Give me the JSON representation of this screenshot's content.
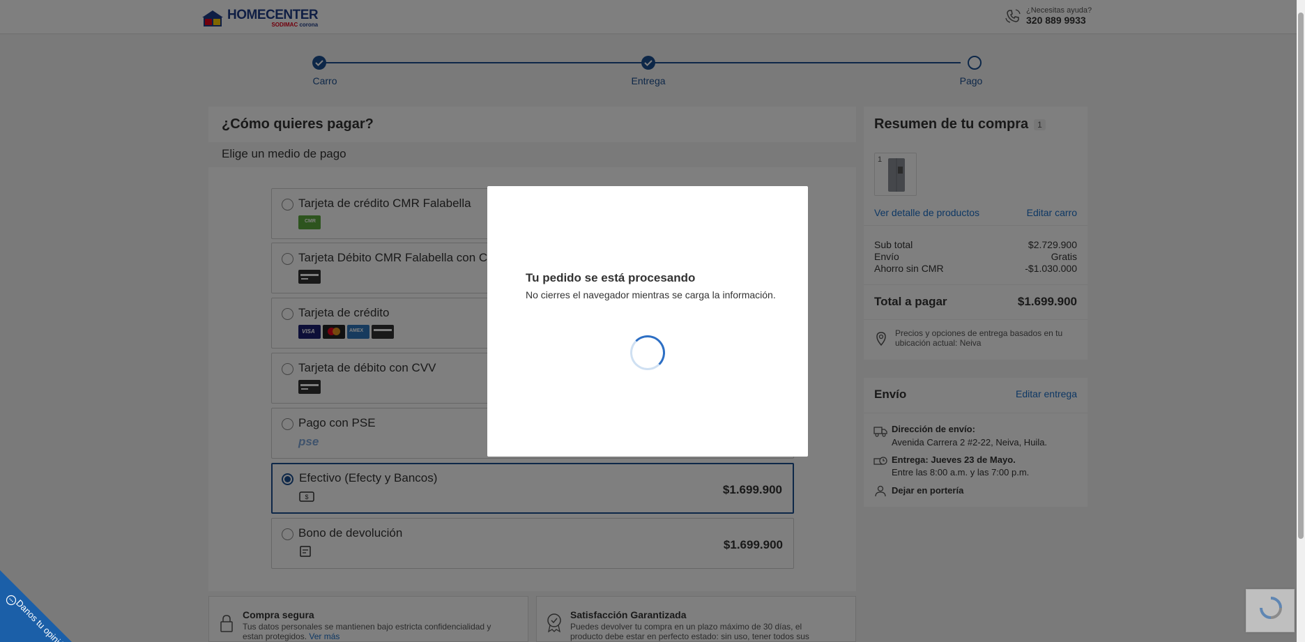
{
  "header": {
    "logo_main": "HOMECENTER",
    "logo_sub_a": "SODIMAC",
    "logo_sub_b": "corona",
    "help_label": "¿Necesitas ayuda?",
    "help_phone": "320 889 9933"
  },
  "stepper": {
    "steps": [
      {
        "label": "Carro",
        "state": "done"
      },
      {
        "label": "Entrega",
        "state": "done"
      },
      {
        "label": "Pago",
        "state": "current"
      }
    ]
  },
  "payment": {
    "title": "¿Cómo quieres pagar?",
    "subtitle": "Elige un medio de pago",
    "methods": [
      {
        "label": "Tarjeta de crédito CMR Falabella",
        "icon": "cmr-card-icon",
        "price": "",
        "selected": false
      },
      {
        "label": "Tarjeta Débito CMR Falabella con CVV",
        "icon": "debit-card-icon",
        "price": "",
        "selected": false
      },
      {
        "label": "Tarjeta de crédito",
        "icon": "credit-card-brands-icon",
        "brands": [
          "VISA",
          "MC",
          "AMEX",
          "CARD"
        ],
        "price": "",
        "selected": false
      },
      {
        "label": "Tarjeta de débito con CVV",
        "icon": "debit-card-icon",
        "price": "",
        "selected": false
      },
      {
        "label": "Pago con PSE",
        "icon": "pse-icon",
        "icon_text": "pse",
        "price": "",
        "selected": false
      },
      {
        "label": "Efectivo (Efecty y Bancos)",
        "icon": "cash-icon",
        "price": "$1.699.900",
        "selected": true
      },
      {
        "label": "Bono de devolución",
        "icon": "voucher-icon",
        "price": "$1.699.900",
        "selected": false
      }
    ]
  },
  "summary": {
    "title": "Resumen de tu compra",
    "count": "1",
    "product_qty": "1",
    "view_details": "Ver detalle de productos",
    "edit_cart": "Editar carro",
    "lines": [
      {
        "label": "Sub total",
        "value": "$2.729.900"
      },
      {
        "label": "Envío",
        "value": "Gratis"
      },
      {
        "label": "Ahorro sin CMR",
        "value": "-$1.030.000"
      }
    ],
    "total_label": "Total a pagar",
    "total_value": "$1.699.900",
    "location_note": "Precios y opciones de entrega basados en tu ubicación actual: Neiva"
  },
  "shipping": {
    "title": "Envío",
    "edit": "Editar entrega",
    "address_label": "Dirección de envío:",
    "address_value": "Avenida Carrera 2 #2-22, Neiva, Huila.",
    "delivery_label": "Entrega: Jueves 23 de Mayo.",
    "delivery_value": "Entre las 8:00 a.m. y las 7:00 p.m.",
    "porter": "Dejar en portería"
  },
  "footer": {
    "secure_title": "Compra segura",
    "secure_text": "Tus datos personales se mantienen bajo estricta confidencialidad y estan protegidos.",
    "secure_link": "Ver más",
    "guarantee_title": "Satisfacción Garantizada",
    "guarantee_text": "Puedes devolver tu compra en un plazo máximo de 30 días, el producto debe estar en perfecto estado: sin uso, tener todos sus accesorios, manuales y"
  },
  "feedback": {
    "label": "Danos tu opinión"
  },
  "modal": {
    "title": "Tu pedido se está procesando",
    "message": "No cierres el navegador mientras se carga la información."
  },
  "colors": {
    "primary": "#1b4f91",
    "link": "#1b6fc8",
    "overlay": "rgba(0,0,0,0.5)"
  }
}
